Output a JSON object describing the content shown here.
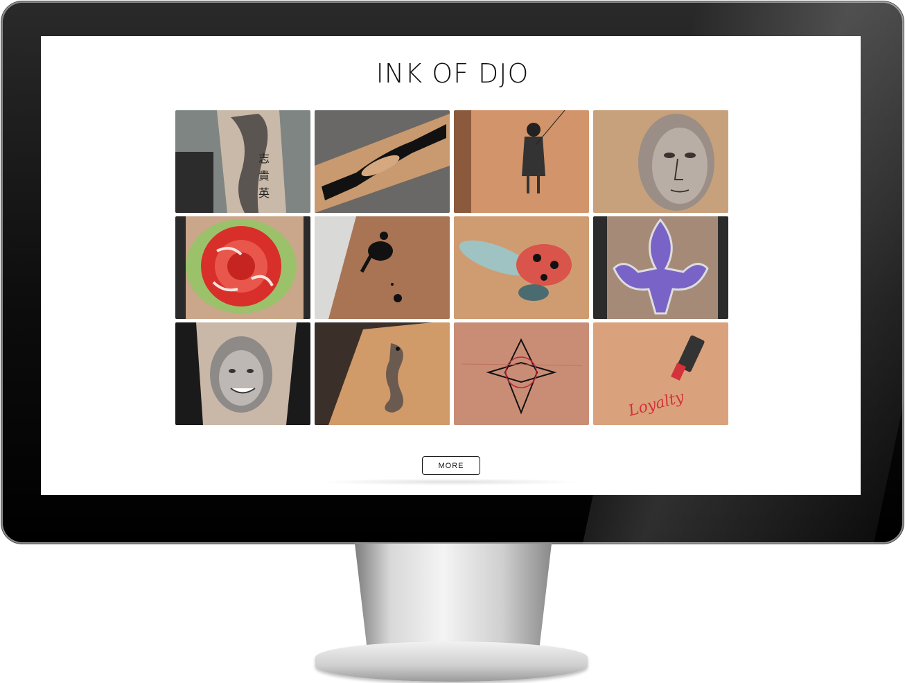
{
  "site": {
    "logo_text": "INK OF DJO"
  },
  "gallery": {
    "tiles": [
      {
        "subject": "biomechanical sleeve with kanji"
      },
      {
        "subject": "tribal band with feather"
      },
      {
        "subject": "girl with balloon"
      },
      {
        "subject": "statue face"
      },
      {
        "subject": "red rose"
      },
      {
        "subject": "blackbird"
      },
      {
        "subject": "ladybug"
      },
      {
        "subject": "purple fleur-de-lis"
      },
      {
        "subject": "smiling portrait"
      },
      {
        "subject": "seahorse"
      },
      {
        "subject": "geometric star"
      },
      {
        "subject": "lipstick",
        "caption": "Loyalty"
      }
    ]
  },
  "more_button": {
    "label": "MORE"
  },
  "colors": {
    "accent": "#111111",
    "background": "#ffffff",
    "bezel": "#0d0d0d"
  }
}
